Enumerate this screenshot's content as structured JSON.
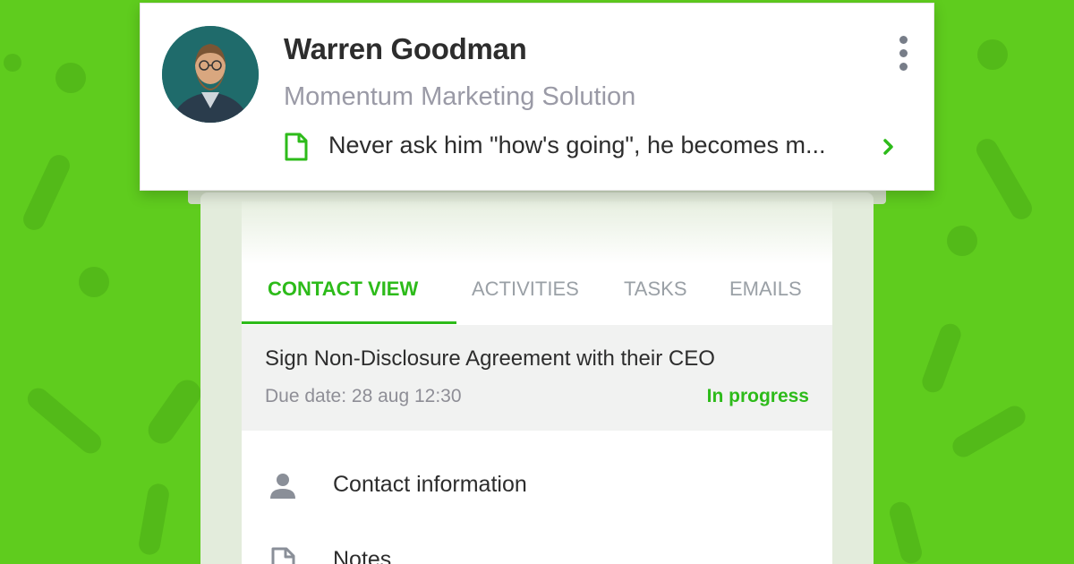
{
  "contact": {
    "name": "Warren Goodman",
    "company": "Momentum Marketing Solution",
    "note": "Never ask him \"how's going\", he becomes m..."
  },
  "tabs": [
    {
      "label": "CONTACT VIEW",
      "active": true
    },
    {
      "label": "ACTIVITIES",
      "active": false
    },
    {
      "label": "TASKS",
      "active": false
    },
    {
      "label": "EMAILS",
      "active": false
    }
  ],
  "task": {
    "title": "Sign Non-Disclosure Agreement with their CEO",
    "due": "Due date: 28 aug 12:30",
    "status": "In progress"
  },
  "menu": [
    {
      "label": "Contact information",
      "icon": "person-icon"
    },
    {
      "label": "Notes",
      "icon": "document-icon"
    }
  ],
  "colors": {
    "accent": "#2dbb1a",
    "background": "#5fcc1e"
  }
}
